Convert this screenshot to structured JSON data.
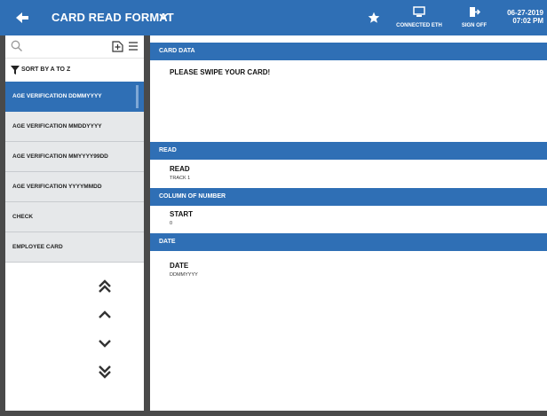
{
  "header": {
    "title": "CARD READ FORMAT",
    "connection_label": "CONNECTED ETH",
    "signoff_label": "SIGN OFF",
    "date": "06-27-2019",
    "time": "07:02 PM"
  },
  "sidebar": {
    "sort_label": "SORT BY A TO Z",
    "items": [
      {
        "label": "AGE VERIFICATION DDMMYYYY"
      },
      {
        "label": "AGE VERIFICATION MMDDYYYY"
      },
      {
        "label": "AGE VERIFICATION MMYYYY99DD"
      },
      {
        "label": "AGE VERIFICATION YYYYMMDD"
      },
      {
        "label": "CHECK"
      },
      {
        "label": "EMPLOYEE CARD"
      }
    ],
    "selected_index": 0
  },
  "main": {
    "card_data": {
      "header": "CARD DATA",
      "message": "PLEASE SWIPE YOUR CARD!"
    },
    "read": {
      "header": "READ",
      "field_label": "READ",
      "field_value": "TRACK 1"
    },
    "column": {
      "header": "COLUMN OF NUMBER",
      "field_label": "START",
      "field_value": "0"
    },
    "date": {
      "header": "DATE",
      "field_label": "DATE",
      "field_value": "DDMMYYYY"
    }
  },
  "colors": {
    "accent": "#2f6fb5",
    "list_bg": "#e6e8ea",
    "frame": "#4a4a4a"
  },
  "icons": [
    "back-arrow-icon",
    "chevron-down-icon",
    "star-icon",
    "network-icon",
    "sign-off-icon",
    "search-icon",
    "add-icon",
    "menu-icon",
    "funnel-icon",
    "double-chevron-up-icon",
    "chevron-up-icon",
    "chevron-down-icon",
    "double-chevron-down-icon"
  ]
}
